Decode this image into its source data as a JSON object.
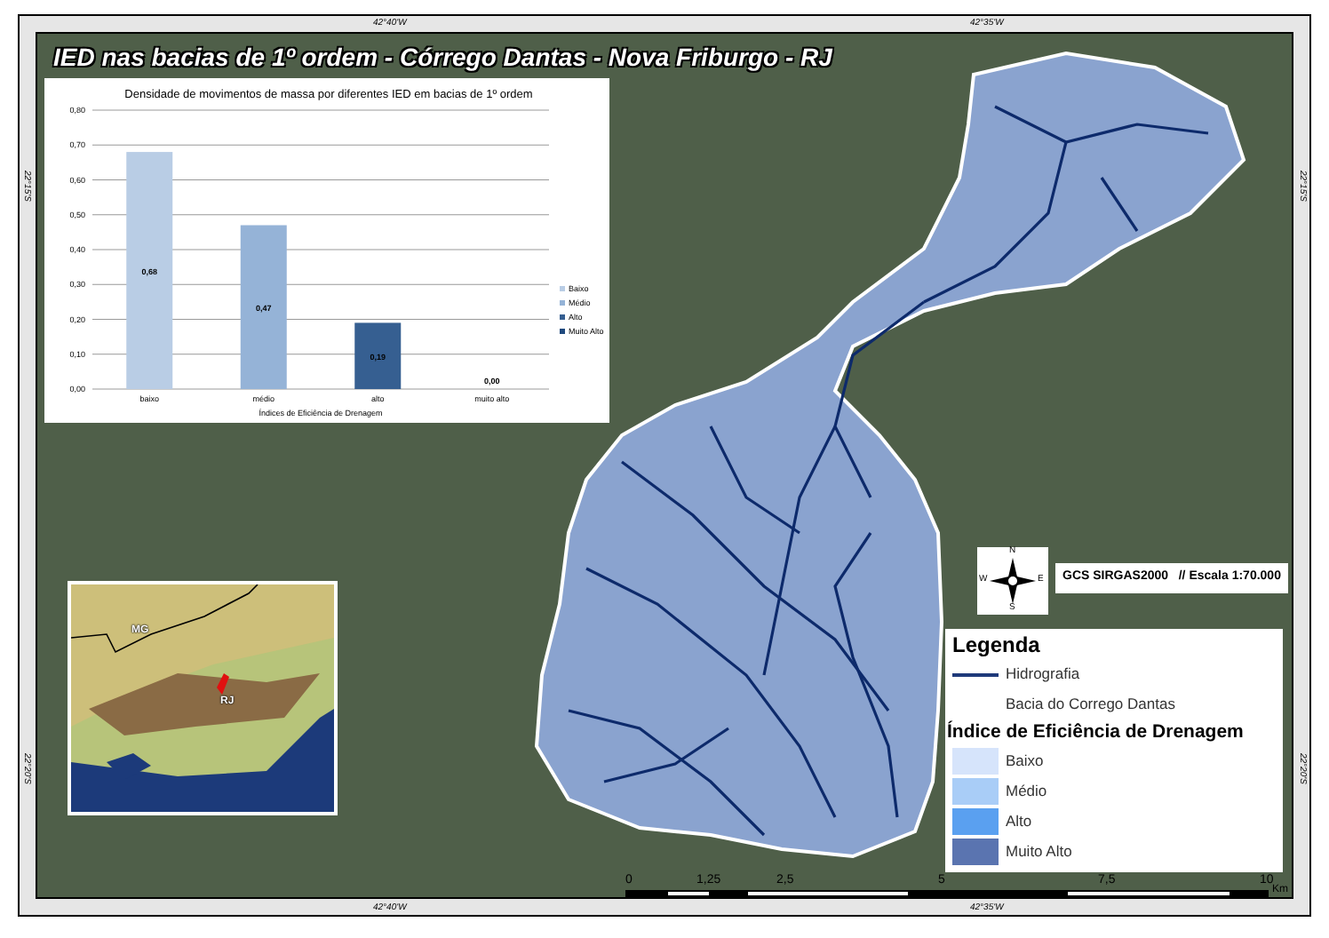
{
  "map": {
    "title": "IED nas bacias de 1º ordem - Córrego Dantas - Nova Friburgo - RJ",
    "grid_top": [
      "42°40'W",
      "42°35'W"
    ],
    "grid_bottom": [
      "42°40'W",
      "42°35'W"
    ],
    "grid_right": [
      "22°15'S",
      "22°20'S"
    ],
    "grid_left": [
      "22°15'S",
      "22°20'S"
    ]
  },
  "chart": {
    "chart_data": {
      "type": "bar",
      "title": "Densidade de movimentos de massa por diferentes IED em bacias  de 1º ordem",
      "xlabel": "Índices de Eficiência de Drenagem",
      "categories": [
        "baixo",
        "médio",
        "alto",
        "muito alto"
      ],
      "series": [
        {
          "name": "Baixo",
          "color": "#b9cde5",
          "values": [
            0.68,
            null,
            null,
            null
          ]
        },
        {
          "name": "Médio",
          "color": "#95b3d7",
          "values": [
            null,
            0.47,
            null,
            null
          ]
        },
        {
          "name": "Alto",
          "color": "#365f91",
          "values": [
            null,
            null,
            0.19,
            null
          ]
        },
        {
          "name": "Muito Alto",
          "color": "#1f497d",
          "values": [
            null,
            null,
            null,
            0.0
          ]
        }
      ],
      "ylim": [
        0,
        0.8
      ],
      "grid": true,
      "legend": "right",
      "yticks": [
        {
          "value": 0,
          "label": "0,00"
        },
        {
          "value": 0.1,
          "label": "0,10"
        },
        {
          "value": 0.2,
          "label": "0,20"
        },
        {
          "value": 0.3,
          "label": "0,30"
        },
        {
          "value": 0.4,
          "label": "0,40"
        },
        {
          "value": 0.5,
          "label": "0,50"
        },
        {
          "value": 0.6,
          "label": "0,60"
        },
        {
          "value": 0.7,
          "label": "0,70"
        },
        {
          "value": 0.8,
          "label": "0,80"
        }
      ],
      "value_labels": [
        "0,68",
        "0,47",
        "0,19",
        "0,00"
      ]
    }
  },
  "inset_map": {
    "labels": [
      "MG",
      "RJ"
    ]
  },
  "compass": {
    "labels": [
      "N",
      "E",
      "S",
      "W"
    ]
  },
  "projection_note": "GCS SIRGAS2000   // Escala 1:70.000",
  "legend": {
    "title": "Legenda",
    "items": [
      {
        "kind": "line",
        "label": "Hidrografia",
        "color": "#1f3a7a"
      },
      {
        "kind": "plain",
        "label": "Bacia do Corrego Dantas"
      }
    ],
    "subtitle": "Índice de Eficiência de Drenagem",
    "classes": [
      {
        "label": "Baixo",
        "color": "#d6e4fb"
      },
      {
        "label": "Médio",
        "color": "#a9cdf7"
      },
      {
        "label": "Alto",
        "color": "#5aa0f0"
      },
      {
        "label": "Muito Alto",
        "color": "#5a74b0"
      }
    ]
  },
  "scale_bar": {
    "labels": [
      "0",
      "1,25",
      "2,5",
      "5",
      "7,5",
      "10"
    ],
    "unit": "Km"
  }
}
